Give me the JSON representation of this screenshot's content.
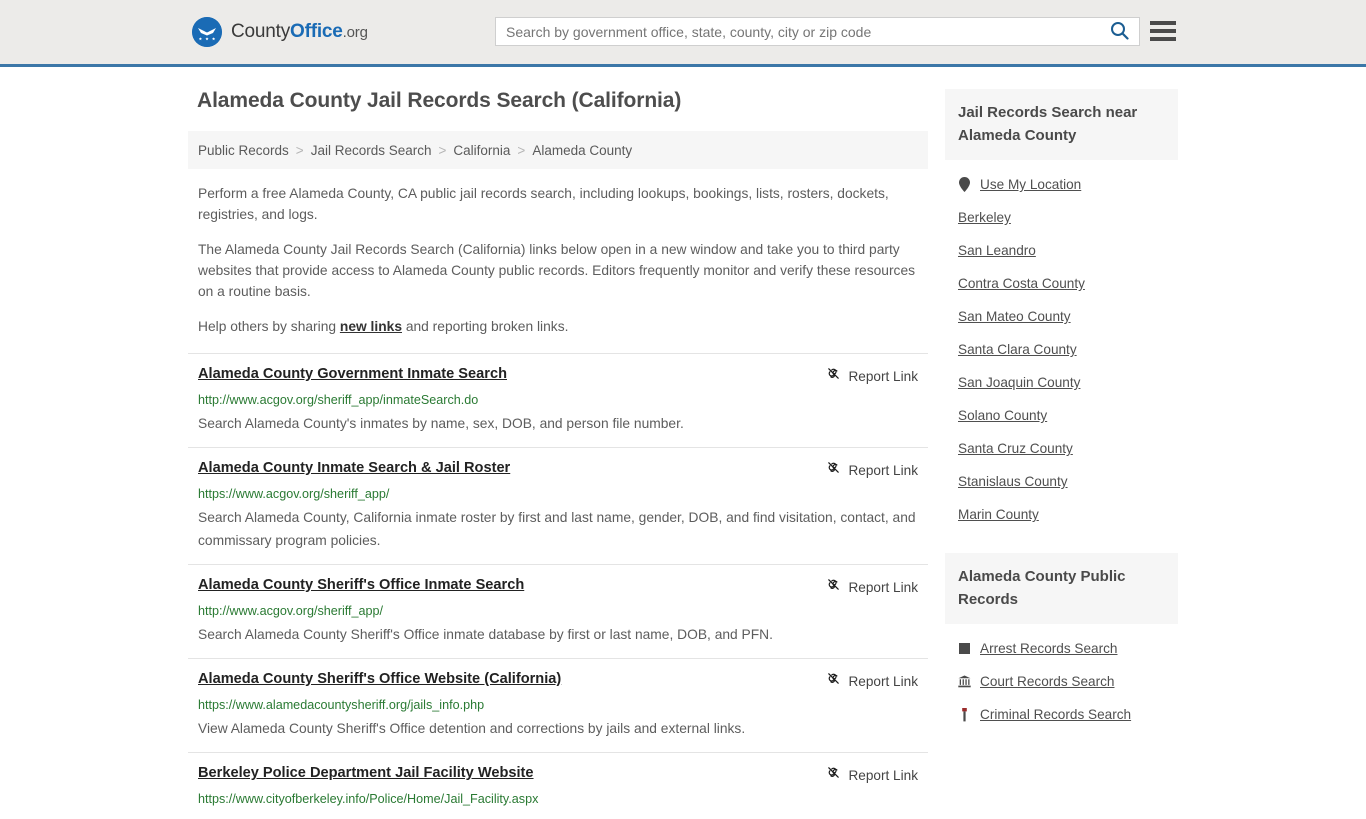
{
  "header": {
    "brand": {
      "part1": "County",
      "part2": "Office",
      "part3": ".org",
      "logo_icon": "eagle-stars-logo"
    },
    "search": {
      "placeholder": "Search by government office, state, county, city or zip code",
      "value": "",
      "search_icon": "search-icon"
    },
    "menu_icon": "hamburger-menu-icon"
  },
  "main": {
    "title": "Alameda County Jail Records Search (California)",
    "breadcrumb": [
      {
        "label": "Public Records"
      },
      {
        "label": "Jail Records Search"
      },
      {
        "label": "California"
      },
      {
        "label": "Alameda County"
      }
    ],
    "breadcrumb_separator": ">",
    "intro": {
      "p1": "Perform a free Alameda County, CA public jail records search, including lookups, bookings, lists, rosters, dockets, registries, and logs.",
      "p2": "The Alameda County Jail Records Search (California) links below open in a new window and take you to third party websites that provide access to Alameda County public records. Editors frequently monitor and verify these resources on a routine basis.",
      "p3_before": "Help others by sharing ",
      "p3_link": "new links",
      "p3_after": " and reporting broken links."
    },
    "report_link_label": "Report Link",
    "report_link_icon": "broken-link-icon",
    "results": [
      {
        "title": "Alameda County Government Inmate Search",
        "url": "http://www.acgov.org/sheriff_app/inmateSearch.do",
        "description": "Search Alameda County's inmates by name, sex, DOB, and person file number."
      },
      {
        "title": "Alameda County Inmate Search & Jail Roster",
        "url": "https://www.acgov.org/sheriff_app/",
        "description": "Search Alameda County, California inmate roster by first and last name, gender, DOB, and find visitation, contact, and commissary program policies."
      },
      {
        "title": "Alameda County Sheriff's Office Inmate Search",
        "url": "http://www.acgov.org/sheriff_app/",
        "description": "Search Alameda County Sheriff's Office inmate database by first or last name, DOB, and PFN."
      },
      {
        "title": "Alameda County Sheriff's Office Website (California)",
        "url": "https://www.alamedacountysheriff.org/jails_info.php",
        "description": "View Alameda County Sheriff's Office detention and corrections by jails and external links."
      },
      {
        "title": "Berkeley Police Department Jail Facility Website",
        "url": "https://www.cityofberkeley.info/Police/Home/Jail_Facility.aspx",
        "description": ""
      }
    ]
  },
  "sidebar": {
    "nearby": {
      "title": "Jail Records Search near Alameda County",
      "items": [
        {
          "label": "Use My Location",
          "icon": "map-pin-icon"
        },
        {
          "label": "Berkeley",
          "icon": ""
        },
        {
          "label": "San Leandro",
          "icon": ""
        },
        {
          "label": "Contra Costa County",
          "icon": ""
        },
        {
          "label": "San Mateo County",
          "icon": ""
        },
        {
          "label": "Santa Clara County",
          "icon": ""
        },
        {
          "label": "San Joaquin County",
          "icon": ""
        },
        {
          "label": "Solano County",
          "icon": ""
        },
        {
          "label": "Santa Cruz County",
          "icon": ""
        },
        {
          "label": "Stanislaus County",
          "icon": ""
        },
        {
          "label": "Marin County",
          "icon": ""
        }
      ]
    },
    "public_records": {
      "title": "Alameda County Public Records",
      "items": [
        {
          "label": "Arrest Records Search",
          "icon": "fingerprint-card-icon"
        },
        {
          "label": "Court Records Search",
          "icon": "courthouse-icon"
        },
        {
          "label": "Criminal Records Search",
          "icon": "gavel-icon"
        }
      ]
    }
  },
  "colors": {
    "header_bg": "#ecebe9",
    "header_border": "#3c77a8",
    "brand_blue": "#1a6bb5",
    "url_green": "#2a7a33",
    "panel_bg": "#f6f6f6"
  }
}
